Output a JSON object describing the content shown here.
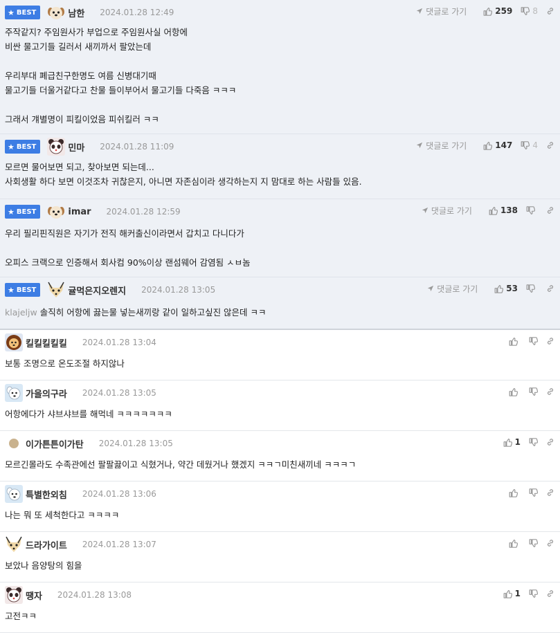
{
  "ui": {
    "best_label": "BEST",
    "goto_label": "댓글로 가기"
  },
  "colors": {
    "best_bg": "#eef1f6",
    "badge": "#3d7de4"
  },
  "best_comments": [
    {
      "nick": "남한",
      "time": "2024.01.28 12:49",
      "avatar": "puppy-avatar",
      "likes": "259",
      "dislikes": "8",
      "lines": [
        "주작같지? 주임원사가 부업으로 주임원사실 어항에",
        "비싼 물고기들 길러서 새끼까서 팔았는데",
        "",
        "우리부대 폐급친구한명도 여름 신병대기때",
        "물고기들 더울거같다고 찬물 들이부어서 물고기들 다죽음 ㅋㅋㅋ",
        "",
        "그래서 걔별명이 피킬이었음 피쉬킬러 ㅋㅋ"
      ]
    },
    {
      "nick": "민마",
      "time": "2024.01.28 11:09",
      "avatar": "panda-avatar",
      "likes": "147",
      "dislikes": "4",
      "lines": [
        "모르면 물어보면 되고, 찾아보면 되는데...",
        "사회생활 하다 보면 이것조차 귀찮은지, 아니면 자존심이라 생각하는지 지 맘대로 하는 사람들 있음."
      ]
    },
    {
      "nick": "imar",
      "time": "2024.01.28 12:59",
      "avatar": "puppy-avatar",
      "likes": "138",
      "dislikes": "",
      "lines": [
        "우리 필리핀직원은 자기가 전직 해커출신이라면서 갑치고 다니다가",
        "",
        "오피스 크랙으로 인증해서 회사컴 90%이상 랜섬웨어 감염됨 ㅅㅂ놈"
      ]
    },
    {
      "nick": "귤먹은지오렌지",
      "time": "2024.01.28 13:05",
      "avatar": "fox-avatar",
      "likes": "53",
      "dislikes": "",
      "author_tag": "klajeljw",
      "lines": [
        "솔직히 어항에 끓는물 넣는새끼랑 같이 일하고싶진 않은데 ㅋㅋ"
      ]
    }
  ],
  "comments": [
    {
      "nick": "킬킬킬킬킬",
      "time": "2024.01.28 13:04",
      "avatar": "lion-avatar",
      "likes": "",
      "text": "보통 조명으로 온도조절 하지않나"
    },
    {
      "nick": "가을의구라",
      "time": "2024.01.28 13:05",
      "avatar": "dog-avatar",
      "likes": "",
      "text": "어항에다가 샤브샤브를 해먹네 ㅋㅋㅋㅋㅋㅋㅋ"
    },
    {
      "nick": "이가튼튼이가탄",
      "time": "2024.01.28 13:05",
      "avatar": "dot-avatar",
      "likes": "1",
      "text": "모르긴몰라도 수족관에선 팔팔끓이고 식혔거나, 약간 데웠거나 했겠지 ㅋㅋㄱ미친새끼네 ㅋㅋㅋㄱ"
    },
    {
      "nick": "특별한외침",
      "time": "2024.01.28 13:06",
      "avatar": "dog-avatar",
      "likes": "",
      "text": "나는 뭐 또 세척한다고 ㅋㅋㅋㅋ"
    },
    {
      "nick": "드라가이트",
      "time": "2024.01.28 13:07",
      "avatar": "fox-avatar",
      "likes": "",
      "text": "보았나 음양탕의 힘을"
    },
    {
      "nick": "땡자",
      "time": "2024.01.28 13:08",
      "avatar": "panda-avatar",
      "likes": "1",
      "text": "고전ㅋㅋ"
    }
  ]
}
